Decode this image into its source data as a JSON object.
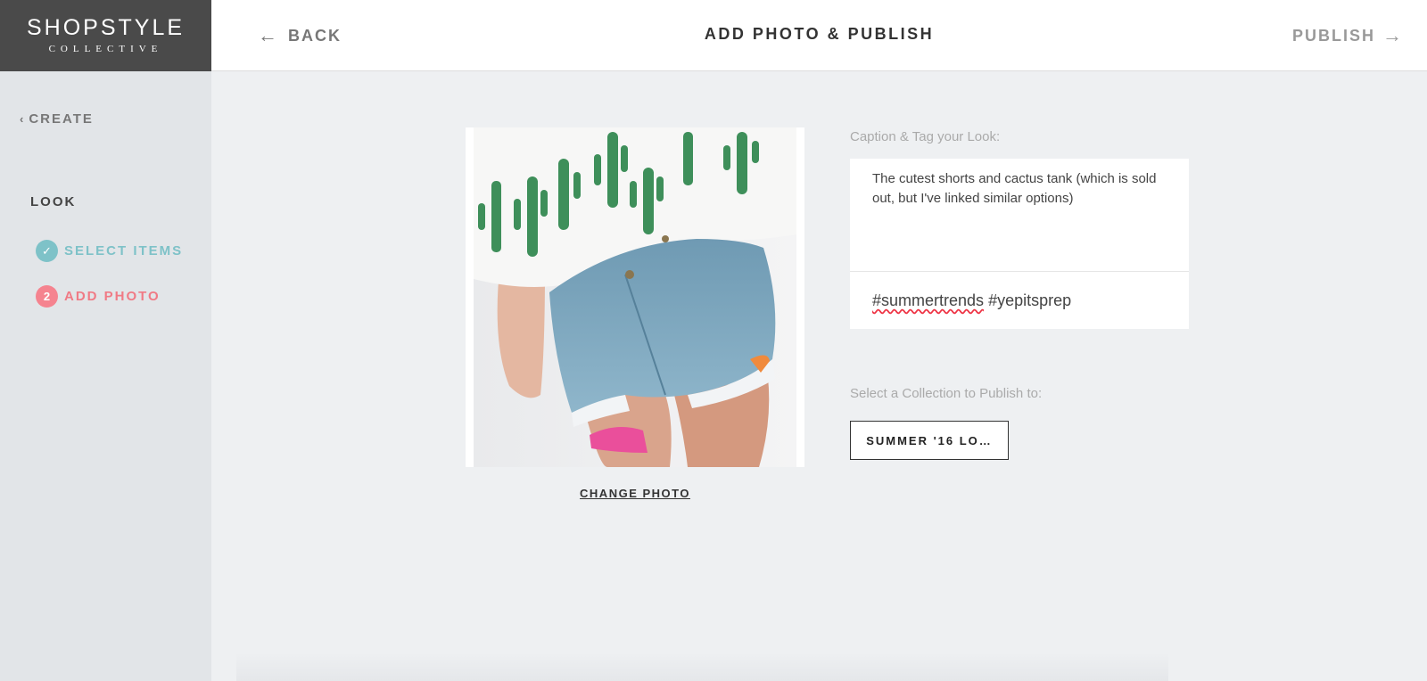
{
  "brand": {
    "name": "SHOPSTYLE",
    "sub": "COLLECTIVE"
  },
  "header": {
    "back_label": "BACK",
    "title": "ADD PHOTO & PUBLISH",
    "publish_label": "PUBLISH"
  },
  "sidebar": {
    "create_label": "CREATE",
    "section_label": "LOOK",
    "steps": [
      {
        "label": "SELECT ITEMS",
        "badge": "✓",
        "status": "complete"
      },
      {
        "label": "ADD PHOTO",
        "badge": "2",
        "status": "current"
      }
    ]
  },
  "photo": {
    "change_label": "CHANGE PHOTO"
  },
  "caption": {
    "label": "Caption & Tag your Look:",
    "text": "The cutest shorts and cactus tank (which is sold out, but I've linked similar options)",
    "tag_1": "#summertrends",
    "tag_2": "#yepitsprep"
  },
  "collection": {
    "label": "Select a Collection to Publish to:",
    "selected": "SUMMER '16 LO…"
  },
  "colors": {
    "teal": "#7ec2c8",
    "pink": "#f5838f",
    "logo_bg": "#4a4a4a"
  }
}
